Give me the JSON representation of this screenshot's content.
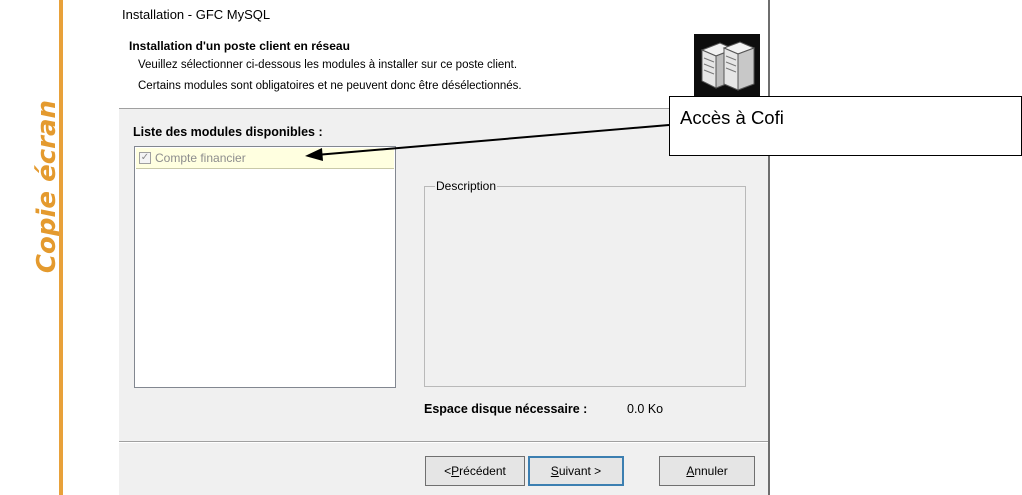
{
  "side_label": "Copie écran",
  "window": {
    "title": "Installation - GFC MySQL",
    "header": {
      "title": "Installation d'un poste client en réseau",
      "line1": "Veuillez sélectionner ci-dessous les modules à installer sur ce poste client.",
      "line2": "Certains modules sont obligatoires et ne peuvent donc être désélectionnés."
    },
    "modules_label": "Liste des modules disponibles :",
    "modules": [
      {
        "label": "Compte financier",
        "checked": true,
        "disabled": true
      }
    ],
    "description_legend": "Description",
    "disk_label": "Espace disque nécessaire :",
    "disk_value": "0.0 Ko",
    "buttons": {
      "prev_prefix": "< ",
      "prev_accel": "P",
      "prev_rest": "récédent",
      "next_accel": "S",
      "next_rest": "uivant >",
      "cancel_accel": "A",
      "cancel_rest": "nnuler"
    }
  },
  "callout": {
    "text": "Accès à Cofi"
  }
}
